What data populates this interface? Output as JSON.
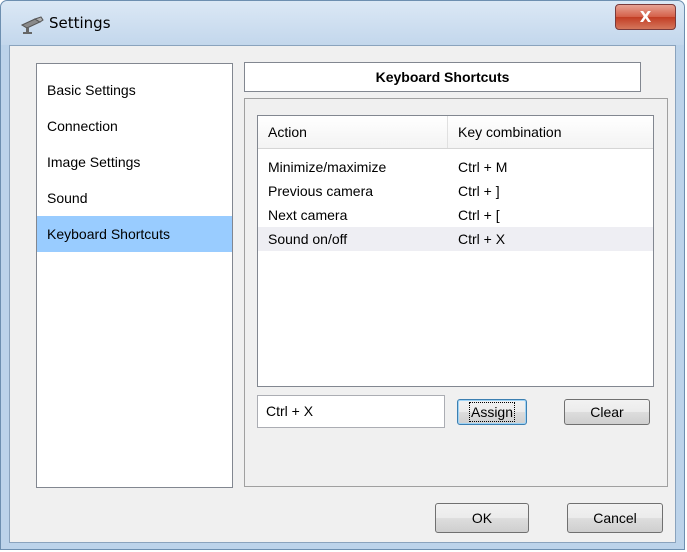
{
  "window": {
    "title": "Settings",
    "close_label": "X",
    "app_icon": "camera-icon"
  },
  "sidebar": {
    "items": [
      {
        "label": "Basic Settings",
        "selected": false
      },
      {
        "label": "Connection",
        "selected": false
      },
      {
        "label": "Image Settings",
        "selected": false
      },
      {
        "label": "Sound",
        "selected": false
      },
      {
        "label": "Keyboard Shortcuts",
        "selected": true
      }
    ]
  },
  "section": {
    "title": "Keyboard Shortcuts"
  },
  "table": {
    "headers": {
      "action": "Action",
      "key": "Key combination"
    },
    "rows": [
      {
        "action": "Minimize/maximize",
        "key": "Ctrl + M"
      },
      {
        "action": "Previous camera",
        "key": "Ctrl + ]"
      },
      {
        "action": "Next camera",
        "key": "Ctrl + ["
      },
      {
        "action": "Sound on/off",
        "key": "Ctrl + X"
      }
    ],
    "selected_row": 3
  },
  "editor": {
    "key_value": "Ctrl + X",
    "assign_label": "Assign",
    "clear_label": "Clear"
  },
  "footer": {
    "ok_label": "OK",
    "cancel_label": "Cancel"
  },
  "colors": {
    "selection": "#99ccff",
    "close_button": "#c9462c"
  }
}
